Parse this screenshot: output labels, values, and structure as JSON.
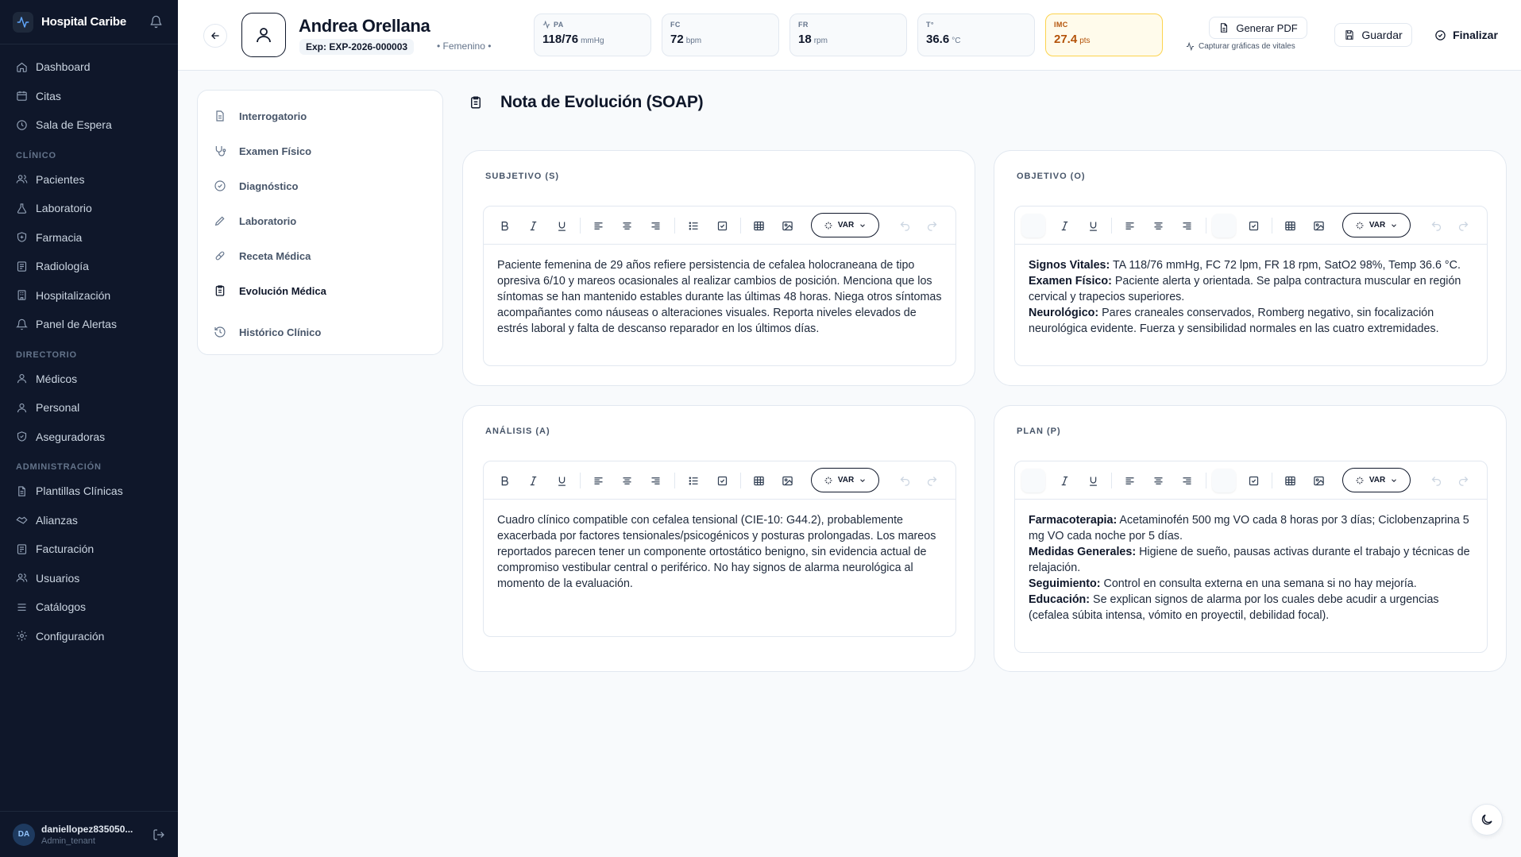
{
  "brand": {
    "name": "Hospital Caribe"
  },
  "sidebar": {
    "top_items": [
      {
        "label": "Dashboard",
        "icon": "home-icon"
      },
      {
        "label": "Citas",
        "icon": "calendar-icon"
      },
      {
        "label": "Sala de Espera",
        "icon": "clock-icon"
      }
    ],
    "sections": [
      {
        "title": "CLÍNICO",
        "items": [
          {
            "label": "Pacientes",
            "icon": "users-icon"
          },
          {
            "label": "Laboratorio",
            "icon": "flask-icon"
          },
          {
            "label": "Farmacia",
            "icon": "pill-icon"
          },
          {
            "label": "Radiología",
            "icon": "radiation-icon"
          },
          {
            "label": "Hospitalización",
            "icon": "building-icon"
          },
          {
            "label": "Panel de Alertas",
            "icon": "bell-icon"
          }
        ]
      },
      {
        "title": "DIRECTORIO",
        "items": [
          {
            "label": "Médicos",
            "icon": "user-icon"
          },
          {
            "label": "Personal",
            "icon": "user-icon"
          },
          {
            "label": "Aseguradoras",
            "icon": "shield-icon"
          }
        ]
      },
      {
        "title": "ADMINISTRACIÓN",
        "items": [
          {
            "label": "Plantillas Clínicas",
            "icon": "document-icon"
          },
          {
            "label": "Alianzas",
            "icon": "handshake-icon"
          },
          {
            "label": "Facturación",
            "icon": "receipt-icon"
          },
          {
            "label": "Usuarios",
            "icon": "users-icon"
          },
          {
            "label": "Catálogos",
            "icon": "list-icon"
          },
          {
            "label": "Configuración",
            "icon": "gear-icon"
          }
        ]
      }
    ],
    "user": {
      "initials": "DA",
      "name": "daniellopez835050...",
      "role": "Admin_tenant"
    }
  },
  "patient": {
    "name": "Andrea Orellana",
    "exp": "Exp: EXP-2026-000003",
    "gender": "• Femenino •"
  },
  "vitals": [
    {
      "label": "PA",
      "value": "118/76",
      "unit": "mmHg"
    },
    {
      "label": "FC",
      "value": "72",
      "unit": "bpm"
    },
    {
      "label": "FR",
      "value": "18",
      "unit": "rpm"
    },
    {
      "label": "T°",
      "value": "36.6",
      "unit": "°C"
    },
    {
      "label": "IMC",
      "value": "27.4",
      "unit": "pts"
    }
  ],
  "actions": {
    "pdf": "Generar PDF",
    "capture": "Capturar gráficas de vitales",
    "save": "Guardar",
    "finish": "Finalizar"
  },
  "sections_nav": [
    {
      "label": "Interrogatorio",
      "icon": "clipboard-icon"
    },
    {
      "label": "Examen Físico",
      "icon": "stethoscope-icon"
    },
    {
      "label": "Diagnóstico",
      "icon": "check-circle-icon"
    },
    {
      "label": "Laboratorio",
      "icon": "pencil-icon"
    },
    {
      "label": "Receta Médica",
      "icon": "pill-icon"
    },
    {
      "label": "Evolución Médica",
      "icon": "clipboard-icon"
    },
    {
      "label": "Histórico Clínico",
      "icon": "history-icon"
    }
  ],
  "soap": {
    "title": "Nota de Evolución (SOAP)",
    "var_label": "VAR",
    "subjetivo": {
      "label": "SUBJETIVO (S)",
      "text": "Paciente femenina de 29 años refiere persistencia de cefalea holocraneana de tipo opresiva 6/10 y mareos ocasionales al realizar cambios de posición. Menciona que los síntomas se han mantenido estables durante las últimas 48 horas. Niega otros síntomas acompañantes como náuseas o alteraciones visuales. Reporta niveles elevados de estrés laboral y falta de descanso reparador en los últimos días."
    },
    "objetivo": {
      "label": "OBJETIVO (O)",
      "paragraphs": [
        {
          "lead": "Signos Vitales:",
          "text": " TA 118/76 mmHg, FC 72 lpm, FR 18 rpm, SatO2 98%, Temp 36.6 °C."
        },
        {
          "lead": "Examen Físico:",
          "text": " Paciente alerta y orientada. Se palpa contractura muscular en región cervical y trapecios superiores."
        },
        {
          "lead": "Neurológico:",
          "text": " Pares craneales conservados, Romberg negativo, sin focalización neurológica evidente. Fuerza y sensibilidad normales en las cuatro extremidades."
        }
      ]
    },
    "analisis": {
      "label": "ANÁLISIS (A)",
      "text": "Cuadro clínico compatible con cefalea tensional (CIE-10: G44.2), probablemente exacerbada por factores tensionales/psicogénicos y posturas prolongadas. Los mareos reportados parecen tener un componente ortostático benigno, sin evidencia actual de compromiso vestibular central o periférico. No hay signos de alarma neurológica al momento de la evaluación."
    },
    "plan": {
      "label": "PLAN (P)",
      "paragraphs": [
        {
          "lead": "Farmacoterapia:",
          "text": " Acetaminofén 500 mg VO cada 8 horas por 3 días; Ciclobenzaprina 5 mg VO cada noche por 5 días."
        },
        {
          "lead": "Medidas Generales:",
          "text": " Higiene de sueño, pausas activas durante el trabajo y técnicas de relajación."
        },
        {
          "lead": "Seguimiento:",
          "text": " Control en consulta externa en una semana si no hay mejoría."
        },
        {
          "lead": "Educación:",
          "text": " Se explican signos de alarma por los cuales debe acudir a urgencias (cefalea súbita intensa, vómito en proyectil, debilidad focal)."
        }
      ]
    }
  },
  "colors": {
    "sidebar_bg": "#0f172a",
    "accent_warn": "#b45309",
    "warn_bg": "#fffbeb"
  }
}
